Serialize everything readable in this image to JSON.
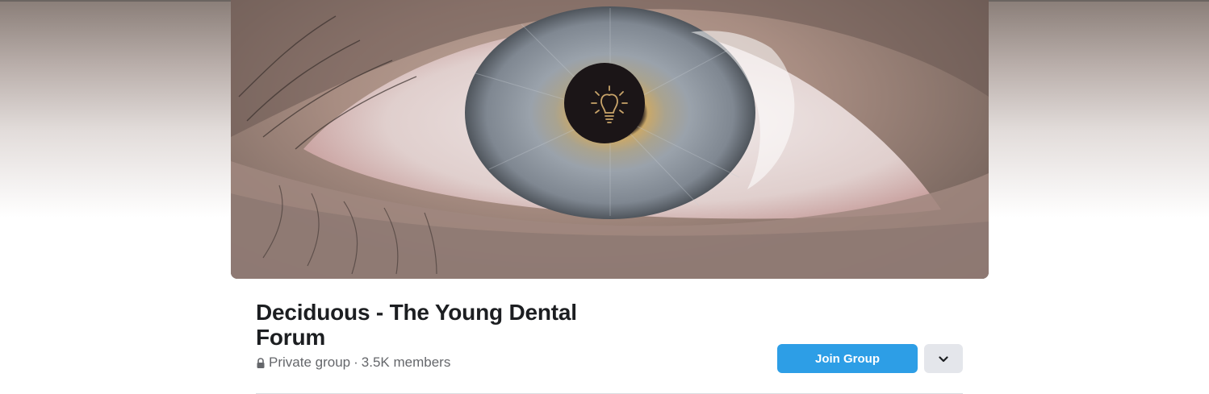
{
  "group": {
    "name": "Deciduous - The Young Dental Forum",
    "privacy": "Private group",
    "separator": "·",
    "members": "3.5K members"
  },
  "cover": {
    "description_icon": "lightbulb-tooth-icon"
  },
  "actions": {
    "join_label": "Join Group",
    "more_icon": "chevron-down-icon"
  },
  "colors": {
    "accent": "#2d9ee6",
    "secondary_button": "#e4e6eb",
    "title": "#1c1e21",
    "meta": "#65676b"
  }
}
